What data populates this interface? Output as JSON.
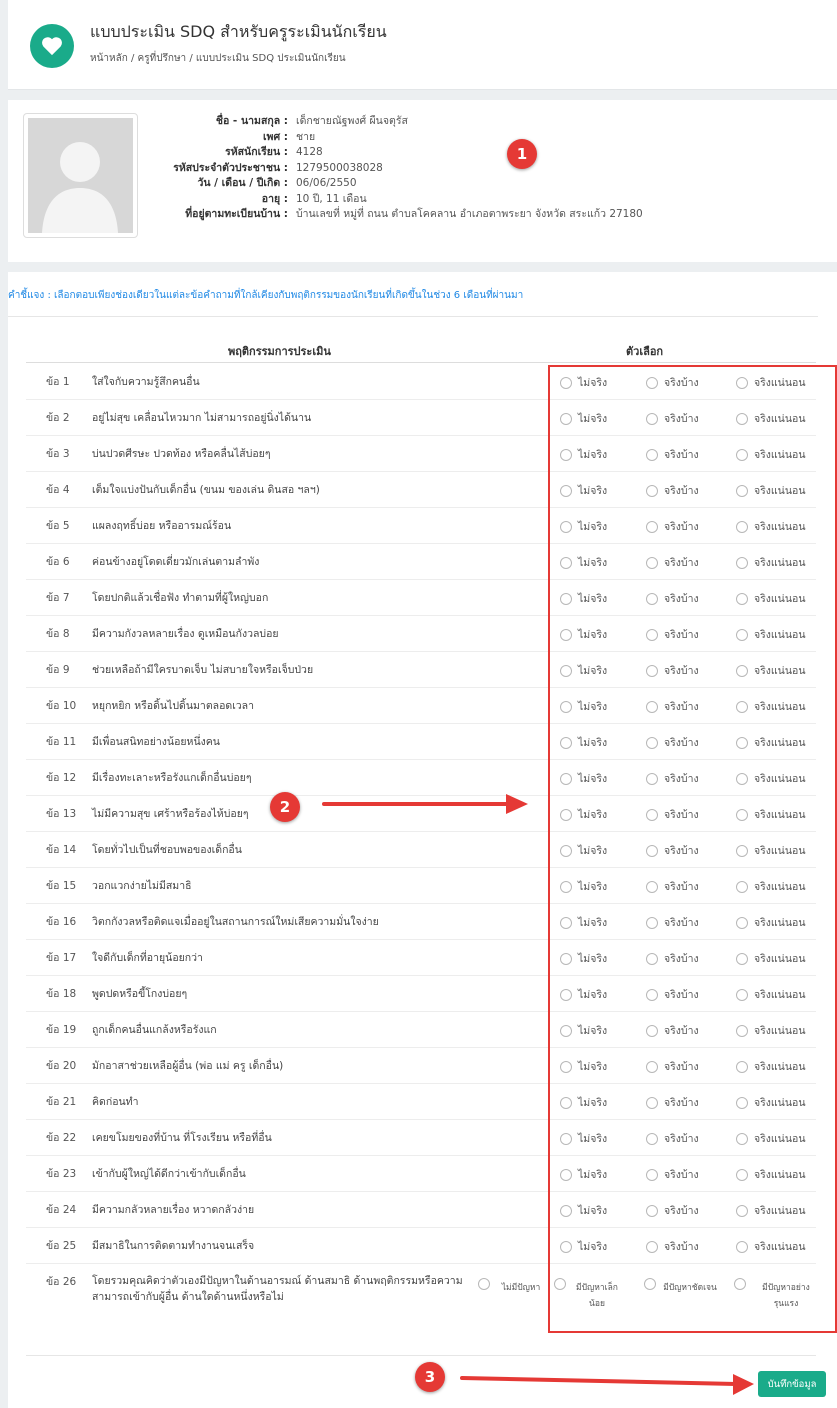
{
  "header": {
    "title": "แบบประเมิน SDQ สำหรับครูระเมินนักเรียน",
    "breadcrumb": "หน้าหลัก / ครูที่ปรึกษา / แบบประเมิน SDQ ประเมินนักเรียน"
  },
  "student": {
    "fields": [
      {
        "label": "ชื่อ - นามสกุล :",
        "value": "เด็กชายณัฐพงศ์ ผืนจตุรัส"
      },
      {
        "label": "เพศ :",
        "value": "ชาย"
      },
      {
        "label": "รหัสนักเรียน :",
        "value": "4128"
      },
      {
        "label": "รหัสประจำตัวประชาชน :",
        "value": "1279500038028"
      },
      {
        "label": "วัน / เดือน / ปีเกิด :",
        "value": "06/06/2550"
      },
      {
        "label": "อายุ :",
        "value": "10 ปี, 11 เดือน"
      },
      {
        "label": "ที่อยู่ตามทะเบียนบ้าน :",
        "value": "บ้านเลขที่ หมู่ที่ ถนน ตำบลโคคลาน อำเภอตาพระยา จังหวัด สระแก้ว 27180"
      }
    ]
  },
  "annotations": {
    "badge1": "1",
    "badge2": "2",
    "badge3": "3"
  },
  "form": {
    "instruction": "คำชี้แจง : เลือกตอบเพียงช่องเดียวในแต่ละข้อคำถามที่ใกล้เคียงกับพฤติกรรมของนักเรียนที่เกิดขึ้นในช่วง 6 เดือนที่ผ่านมา",
    "header_behavior": "พฤติกรรมการประเมิน",
    "header_options": "ตัวเลือก",
    "options": [
      "ไม่จริง",
      "จริงบ้าง",
      "จริงแน่นอน"
    ],
    "questions": [
      {
        "num": "ข้อ 1",
        "text": "ใส่ใจกับความรู้สึกคนอื่น"
      },
      {
        "num": "ข้อ 2",
        "text": "อยู่ไม่สุข เคลื่อนไหวมาก ไม่สามารถอยู่นิ่งได้นาน"
      },
      {
        "num": "ข้อ 3",
        "text": "บ่นปวดศีรษะ ปวดท้อง หรือคลื่นไส้บ่อยๆ"
      },
      {
        "num": "ข้อ 4",
        "text": "เต็มใจแบ่งปันกับเด็กอื่น (ขนม ของเล่น ดินสอ ฯลฯ)"
      },
      {
        "num": "ข้อ 5",
        "text": "แผลงฤทธิ์บ่อย หรืออารมณ์ร้อน"
      },
      {
        "num": "ข้อ 6",
        "text": "ค่อนข้างอยู่โดดเดี่ยวมักเล่นตามลำพัง"
      },
      {
        "num": "ข้อ 7",
        "text": "โดยปกติแล้วเชื่อฟัง ทำตามที่ผู้ใหญ่บอก"
      },
      {
        "num": "ข้อ 8",
        "text": "มีความกังวลหลายเรื่อง ดูเหมือนกังวลบ่อย"
      },
      {
        "num": "ข้อ 9",
        "text": "ช่วยเหลือถ้ามีใครบาดเจ็บ ไม่สบายใจหรือเจ็บป่วย"
      },
      {
        "num": "ข้อ 10",
        "text": "หยุกหยิก หรือดิ้นไปดิ้นมาตลอดเวลา"
      },
      {
        "num": "ข้อ 11",
        "text": "มีเพื่อนสนิทอย่างน้อยหนึ่งคน"
      },
      {
        "num": "ข้อ 12",
        "text": "มีเรื่องทะเลาะหรือรังแกเด็กอื่นบ่อยๆ"
      },
      {
        "num": "ข้อ 13",
        "text": "ไม่มีความสุข เศร้าหรือร้องไห้บ่อยๆ"
      },
      {
        "num": "ข้อ 14",
        "text": "โดยทั่วไปเป็นที่ชอบพอของเด็กอื่น"
      },
      {
        "num": "ข้อ 15",
        "text": "วอกแวกง่ายไม่มีสมาธิ"
      },
      {
        "num": "ข้อ 16",
        "text": "วิตกกังวลหรือติดแจเมื่ออยู่ในสถานการณ์ใหม่เสียความมั่นใจง่าย"
      },
      {
        "num": "ข้อ 17",
        "text": "ใจดีกับเด็กที่อายุน้อยกว่า"
      },
      {
        "num": "ข้อ 18",
        "text": "พูดปดหรือขี้โกงบ่อยๆ"
      },
      {
        "num": "ข้อ 19",
        "text": "ถูกเด็กคนอื่นแกล้งหรือรังแก"
      },
      {
        "num": "ข้อ 20",
        "text": "มักอาสาช่วยเหลือผู้อื่น (พ่อ แม่ ครู เด็กอื่น)"
      },
      {
        "num": "ข้อ 21",
        "text": "คิดก่อนทำ"
      },
      {
        "num": "ข้อ 22",
        "text": "เคยขโมยของที่บ้าน ที่โรงเรียน หรือที่อื่น"
      },
      {
        "num": "ข้อ 23",
        "text": "เข้ากับผู้ใหญ่ได้ดีกว่าเข้ากับเด็กอื่น"
      },
      {
        "num": "ข้อ 24",
        "text": "มีความกลัวหลายเรื่อง หวาดกลัวง่าย"
      },
      {
        "num": "ข้อ 25",
        "text": "มีสมาธิในการติดตามทำงานจนเสร็จ"
      }
    ],
    "last_question": {
      "num": "ข้อ 26",
      "text": "โดยรวมคุณคิดว่าตัวเองมีปัญหาในด้านอารมณ์ ด้านสมาธิ ด้านพฤติกรรมหรือความสามารถเข้ากับผู้อื่น ด้านใดด้านหนึ่งหรือไม่",
      "options": [
        "ไม่มีปัญหา",
        "มีปัญหาเล็กน้อย",
        "มีปัญหาชัดเจน",
        "มีปัญหาอย่างรุนแรง"
      ]
    },
    "save_label": "บันทึกข้อมูล"
  },
  "colors": {
    "accent": "#1aab8a",
    "annotation": "#e53935",
    "instruction": "#1e88e5"
  }
}
